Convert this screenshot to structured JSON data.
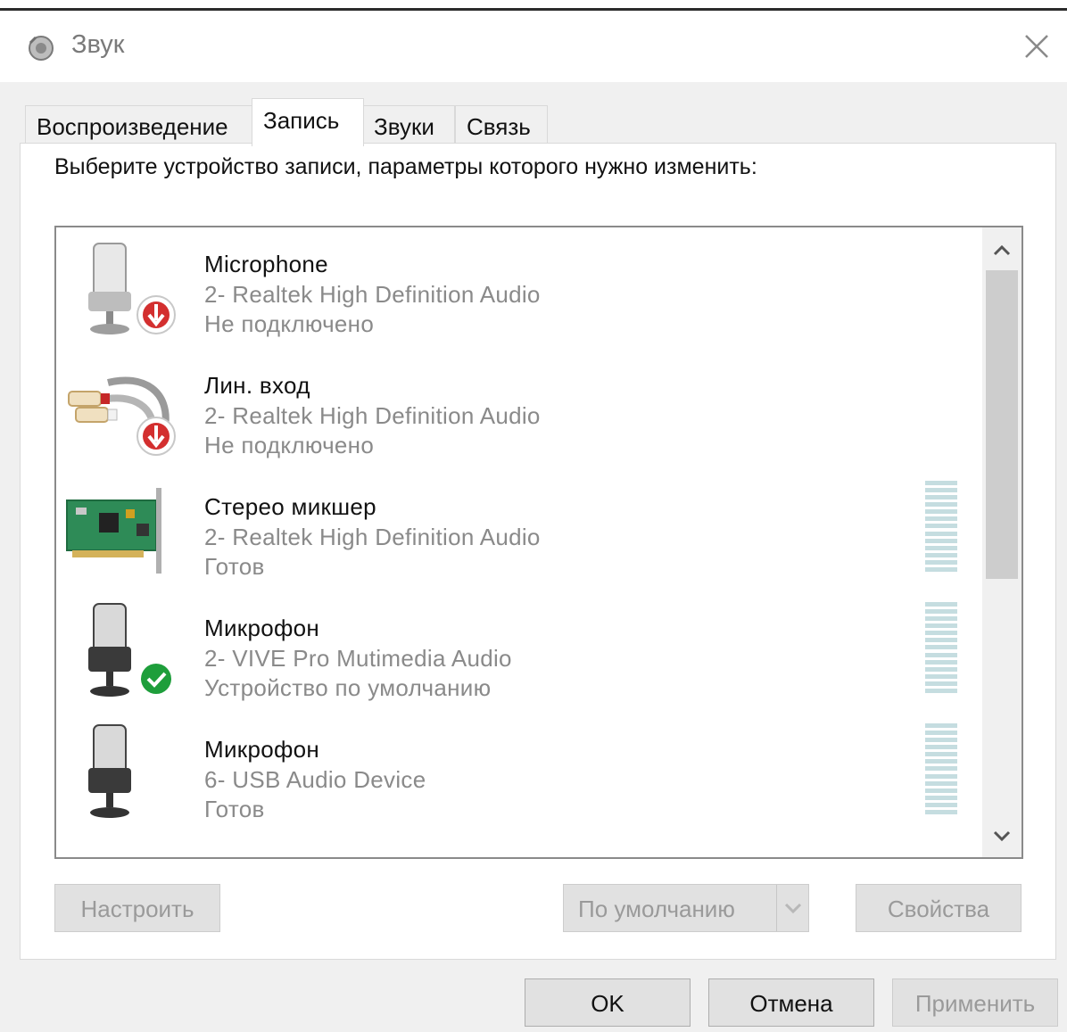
{
  "window": {
    "title": "Звук",
    "close_icon": "close-icon"
  },
  "tabs": [
    {
      "label": "Воспроизведение",
      "active": false
    },
    {
      "label": "Запись",
      "active": true
    },
    {
      "label": "Звуки",
      "active": false
    },
    {
      "label": "Связь",
      "active": false
    }
  ],
  "instruction": "Выберите устройство записи, параметры которого нужно изменить:",
  "devices": [
    {
      "name": "Microphone",
      "driver": "2- Realtek High Definition Audio",
      "status": "Не подключено",
      "icon": "microphone-icon",
      "badge": "disconnected-badge-icon",
      "has_level_meter": false
    },
    {
      "name": "Лин. вход",
      "driver": "2- Realtek High Definition Audio",
      "status": "Не подключено",
      "icon": "line-in-cable-icon",
      "badge": "disconnected-badge-icon",
      "has_level_meter": false
    },
    {
      "name": "Стерео микшер",
      "driver": "2- Realtek High Definition Audio",
      "status": "Готов",
      "icon": "sound-card-icon",
      "badge": null,
      "has_level_meter": true
    },
    {
      "name": "Микрофон",
      "driver": "2- VIVE Pro Mutimedia Audio",
      "status": "Устройство по умолчанию",
      "icon": "microphone-icon",
      "badge": "default-check-badge-icon",
      "has_level_meter": true
    },
    {
      "name": "Микрофон",
      "driver": "6- USB Audio Device",
      "status": "Готов",
      "icon": "microphone-icon",
      "badge": null,
      "has_level_meter": true
    }
  ],
  "buttons": {
    "configure": "Настроить",
    "set_default": "По умолчанию",
    "properties": "Свойства",
    "ok": "OK",
    "cancel": "Отмена",
    "apply": "Применить"
  },
  "colors": {
    "disconnected_badge": "#d32f2f",
    "default_badge": "#1e9e3b",
    "level_meter": "#c5dde0"
  }
}
